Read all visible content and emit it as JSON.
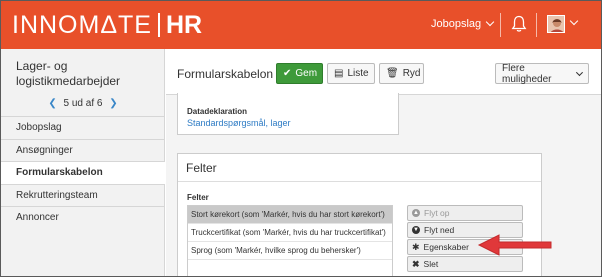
{
  "brand": {
    "name_main": "INNOMΔTE",
    "name_hr": "HR",
    "color": "#e8502a"
  },
  "topnav": {
    "jobopslag_label": "Jobopslag"
  },
  "sidebar": {
    "title": "Lager- og logistikmedarbejder",
    "pager": "5 ud af 6",
    "items": [
      {
        "label": "Jobopslag"
      },
      {
        "label": "Ansøgninger"
      },
      {
        "label": "Formularskabelon",
        "active": true
      },
      {
        "label": "Rekrutteringsteam"
      },
      {
        "label": "Annoncer"
      }
    ]
  },
  "header": {
    "title": "Formularskabelon",
    "save_label": "Gem",
    "list_label": "Liste",
    "clear_label": "Ryd",
    "more_label": "Flere muligheder"
  },
  "datadeklaration": {
    "label": "Datadeklaration",
    "link": "Standardspørgsmål, lager"
  },
  "felter": {
    "panel_title": "Felter",
    "list_label": "Felter",
    "items": [
      {
        "text": "Stort kørekort (som 'Markér, hvis du har stort kørekort')",
        "selected": true
      },
      {
        "text": "Truckcertifikat (som 'Markér, hvis du har truckcertifikat')"
      },
      {
        "text": "Sprog (som 'Markér, hvilke sprog du behersker')"
      }
    ],
    "actions": [
      {
        "label": "Flyt op",
        "icon": "arrow-up-icon",
        "disabled": true
      },
      {
        "label": "Flyt ned",
        "icon": "arrow-down-icon"
      },
      {
        "label": "Egenskaber",
        "icon": "gear-icon"
      },
      {
        "label": "Slet",
        "icon": "close-icon"
      }
    ]
  },
  "colors": {
    "save_button": "#3e9a3a",
    "link": "#2d7bc4",
    "annotation_arrow": "#e0383a"
  }
}
